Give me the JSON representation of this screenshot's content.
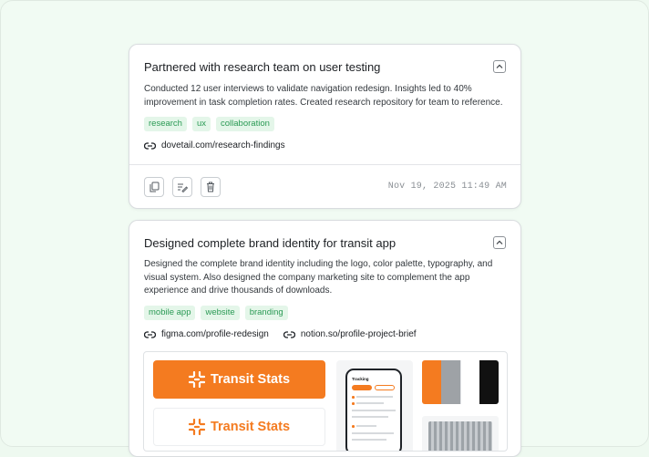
{
  "cards": [
    {
      "title": "Partnered with research team on user testing",
      "description": "Conducted 12 user interviews to validate navigation redesign. Insights led to 40% improvement in task completion rates. Created research repository for team to reference.",
      "tags": [
        "research",
        "ux",
        "collaboration"
      ],
      "links": [
        "dovetail.com/research-findings"
      ],
      "timestamp": "Nov 19, 2025 11:49 AM",
      "actions": [
        "copy-icon",
        "edit-icon",
        "trash-icon"
      ]
    },
    {
      "title": "Designed complete brand identity for transit app",
      "description": "Designed the complete brand identity including the logo, color palette, typography, and visual system. Also designed the company marketing site to complement the app experience and drive thousands of downloads.",
      "tags": [
        "mobile app",
        "website",
        "branding"
      ],
      "links": [
        "figma.com/profile-redesign",
        "notion.so/profile-project-brief"
      ],
      "gallery": {
        "logo_text": "Transit Stats",
        "phone_title": "Tracking",
        "palette_colors": [
          "#f47b20",
          "#9ea2a6",
          "#ffffff",
          "#111111"
        ]
      }
    }
  ],
  "colors": {
    "background": "#eef9f0",
    "tag_bg": "#e4f6e9",
    "tag_text": "#2b9a55",
    "brand_orange": "#f47b20"
  }
}
